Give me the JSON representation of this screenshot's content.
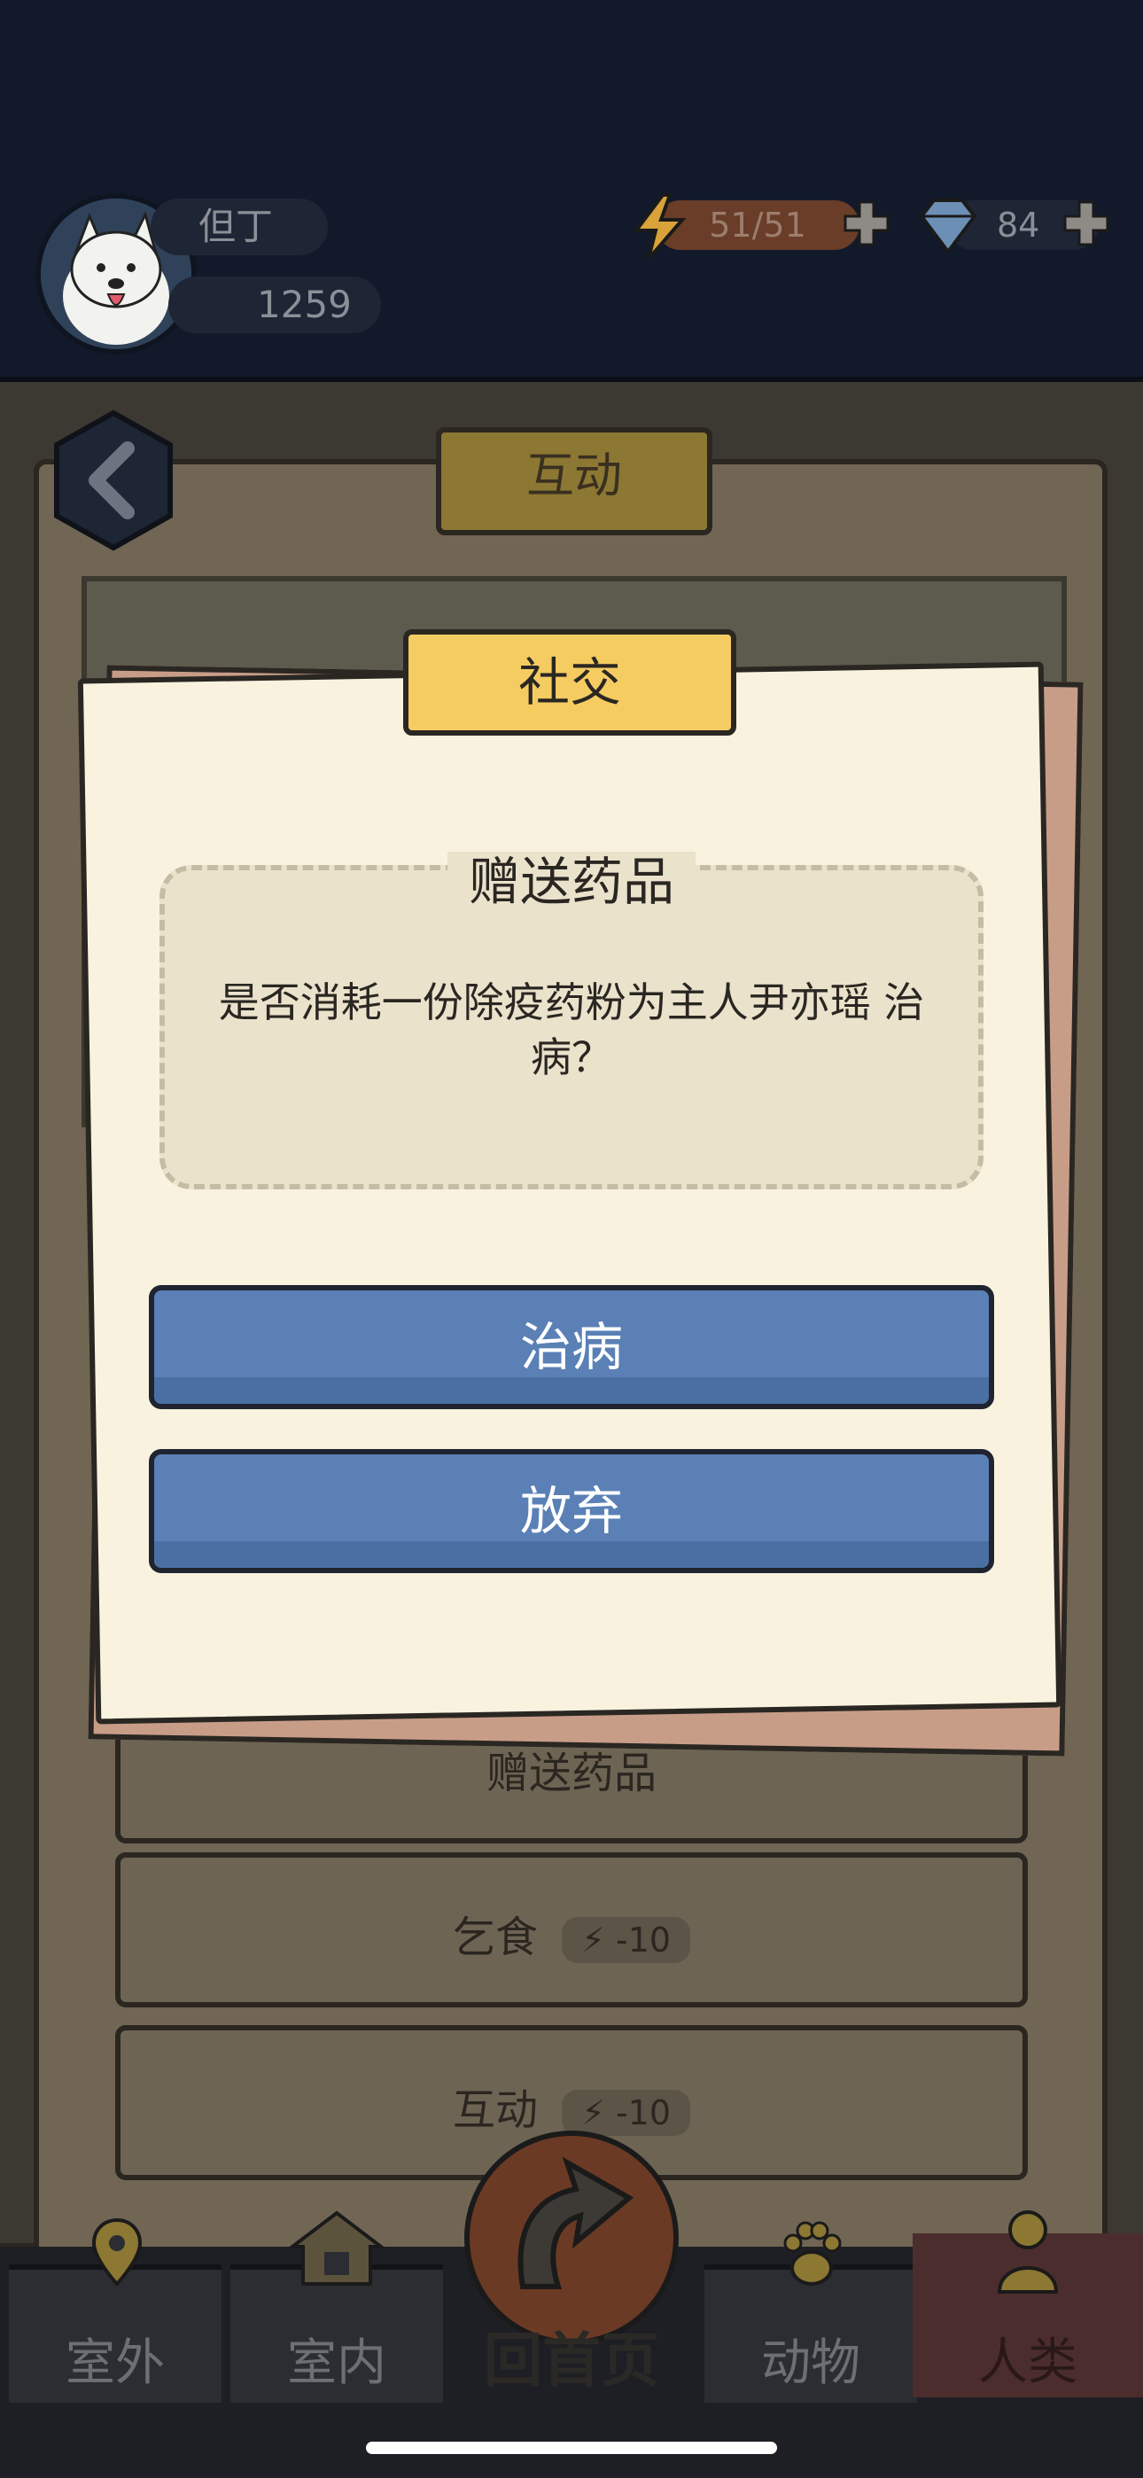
{
  "header": {
    "username": "但丁",
    "crowns": "1259",
    "energy": "51/51",
    "gems": "84"
  },
  "page": {
    "title": "互动",
    "list": [
      {
        "label": "赠送药品",
        "cost": ""
      },
      {
        "label": "乞食",
        "cost": "-10"
      },
      {
        "label": "互动",
        "cost": "-10"
      }
    ]
  },
  "dialog": {
    "ribbon": "社交",
    "title": "赠送药品",
    "message": "是否消耗一份除疫药粉为主人尹亦瑶 治病？",
    "confirm_label": "治病",
    "cancel_label": "放弃"
  },
  "nav": {
    "outdoor": "室外",
    "indoor": "室内",
    "home": "回首页",
    "animals": "动物",
    "humans": "人类"
  },
  "colors": {
    "accent_blue": "#5a80b6",
    "ribbon_yellow": "#f5cc62",
    "header_bg": "#12192a"
  }
}
